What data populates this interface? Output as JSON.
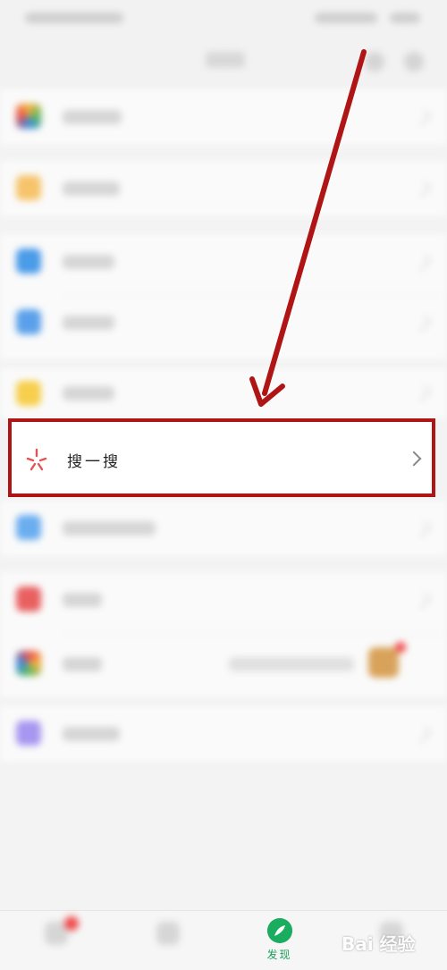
{
  "search_item": {
    "label": "搜一搜"
  },
  "tab_bar": {
    "discover_label": "发现"
  },
  "watermark": {
    "text": "Bai 经验"
  },
  "colors": {
    "highlight_border": "#b01515",
    "arrow": "#b01515",
    "discover_green": "#1aad60"
  },
  "icons": {
    "search": "search-sparkle-icon",
    "discover": "compass-icon",
    "chevron": "chevron-right-icon"
  }
}
